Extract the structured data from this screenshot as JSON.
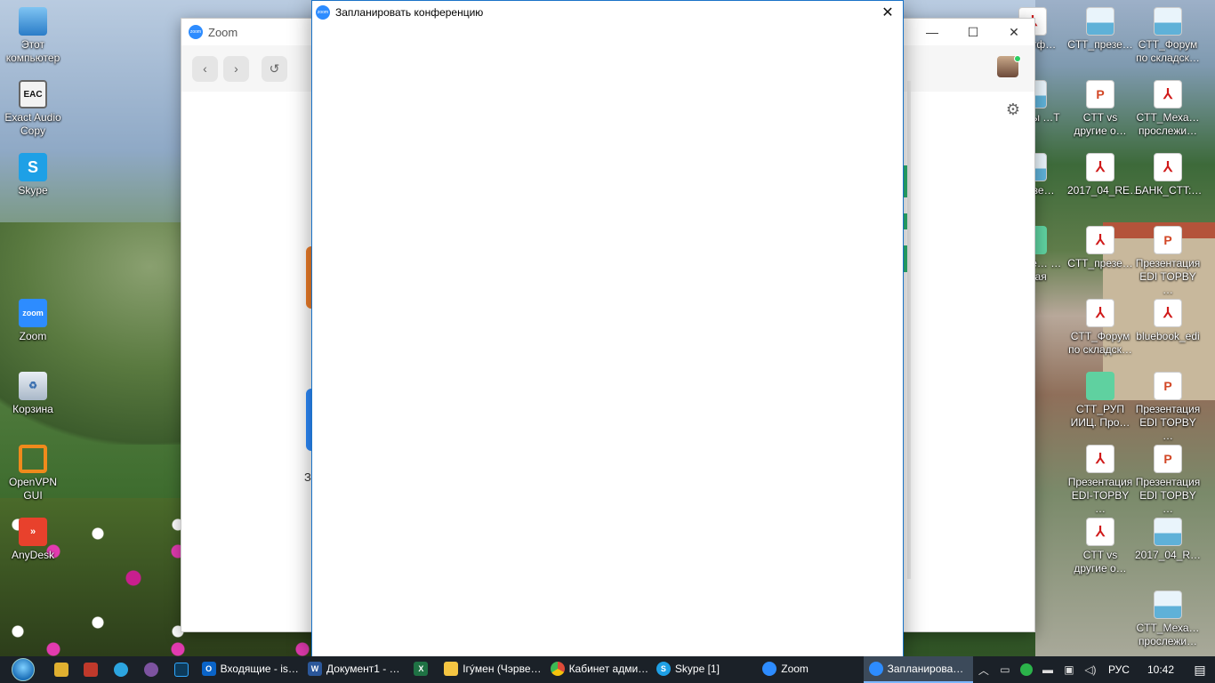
{
  "desktop_left": [
    {
      "label": "Этот компьютер",
      "icon": "this-pc-icon",
      "glyph": ""
    },
    {
      "label": "Exact Audio Copy",
      "icon": "exact-audio-copy-icon",
      "glyph": "EAC"
    },
    {
      "label": "Skype",
      "icon": "skype-icon",
      "glyph": "S"
    },
    {
      "label": "Zoom",
      "icon": "zoom-app-icon",
      "glyph": "zoom"
    },
    {
      "label": "Корзина",
      "icon": "recycle-bin-icon",
      "glyph": "♻"
    },
    {
      "label": "OpenVPN GUI",
      "icon": "openvpn-icon",
      "glyph": ""
    },
    {
      "label": "AnyDesk",
      "icon": "anydesk-icon",
      "glyph": "»"
    }
  ],
  "desktop_right": [
    {
      "label": "…ортф…",
      "icon": "pdf-file-icon",
      "glyph": "⅄"
    },
    {
      "label": "CTT_презе…",
      "icon": "image-file-icon",
      "glyph": ""
    },
    {
      "label": "CTT_Форум по складск…",
      "icon": "image-file-icon",
      "glyph": ""
    },
    {
      "label": "…кисы …Т",
      "icon": "file-icon",
      "glyph": ""
    },
    {
      "label": "CTT vs другие о…",
      "icon": "ppt-file-icon",
      "glyph": "P"
    },
    {
      "label": "CTT_Меха… прослежи…",
      "icon": "pdf-file-icon",
      "glyph": "⅄"
    },
    {
      "label": "…резе…",
      "icon": "file-icon",
      "glyph": ""
    },
    {
      "label": "2017_04_RE…",
      "icon": "pdf-file-icon",
      "glyph": "⅄"
    },
    {
      "label": "БАНК_CTT:…",
      "icon": "pdf-file-icon",
      "glyph": "⅄"
    },
    {
      "label": "…резе… …товая",
      "icon": "file-icon",
      "glyph": ""
    },
    {
      "label": "CTT_презе…",
      "icon": "pdf-file-icon",
      "glyph": "⅄"
    },
    {
      "label": "Презентация EDI TOPBY …",
      "icon": "ppt-file-icon",
      "glyph": "P"
    },
    {
      "label": "CTT_Форум по складск…",
      "icon": "pdf-file-icon",
      "glyph": "⅄"
    },
    {
      "label": "bluebook_edi",
      "icon": "pdf-file-icon",
      "glyph": "⅄"
    },
    {
      "label": "CTT_РУП ИИЦ. Про…",
      "icon": "green-file-icon",
      "glyph": ""
    },
    {
      "label": "Презентация EDI TOPBY …",
      "icon": "ppt-file-icon",
      "glyph": "P"
    },
    {
      "label": "Презентация EDI-TOPBY …",
      "icon": "pdf-file-icon",
      "glyph": "⅄"
    },
    {
      "label": "Презентация EDI TOPBY …",
      "icon": "ppt-file-icon",
      "glyph": "P"
    },
    {
      "label": "CTT vs другие о…",
      "icon": "pdf-file-icon",
      "glyph": "⅄"
    },
    {
      "label": "2017_04_R…",
      "icon": "image-file-icon",
      "glyph": ""
    },
    {
      "label": "CTT_Меха… прослежи…",
      "icon": "image-file-icon",
      "glyph": ""
    }
  ],
  "zoom_window": {
    "title": "Zoom",
    "logo_text": "zoom",
    "minimize": "—",
    "maximize": "☐",
    "close": "✕",
    "back": "‹",
    "forward": "›",
    "history": "↺",
    "tile_label": "З"
  },
  "dialog": {
    "title": "Запланировать конференцию",
    "logo_text": "zoom",
    "close": "✕"
  },
  "taskbar": {
    "tasks": [
      {
        "label": "Входящие - is…",
        "icon": "outlook-icon",
        "glyph": "O",
        "color": "#0a64c8",
        "active": false
      },
      {
        "label": "Документ1 - …",
        "icon": "word-icon",
        "glyph": "W",
        "color": "#2b579a",
        "active": false
      },
      {
        "label": "",
        "icon": "excel-icon",
        "glyph": "X",
        "color": "#1f7244",
        "active": false
      },
      {
        "label": "Ігýмен (Чэрве…",
        "icon": "folder-icon",
        "glyph": "",
        "color": "#f5c542",
        "active": false
      },
      {
        "label": "Кабинет адми…",
        "icon": "chrome-icon",
        "glyph": "",
        "color": "#dd4b39",
        "active": false
      },
      {
        "label": "Skype [1]",
        "icon": "skype-icon",
        "glyph": "S",
        "color": "#1ea0e6",
        "active": false
      },
      {
        "label": "Zoom",
        "icon": "zoom-icon",
        "glyph": "",
        "color": "#2d8cff",
        "active": false
      },
      {
        "label": "Запланирова…",
        "icon": "zoom-icon",
        "glyph": "",
        "color": "#2d8cff",
        "active": true
      }
    ],
    "language": "РУС",
    "time": "10:42"
  }
}
